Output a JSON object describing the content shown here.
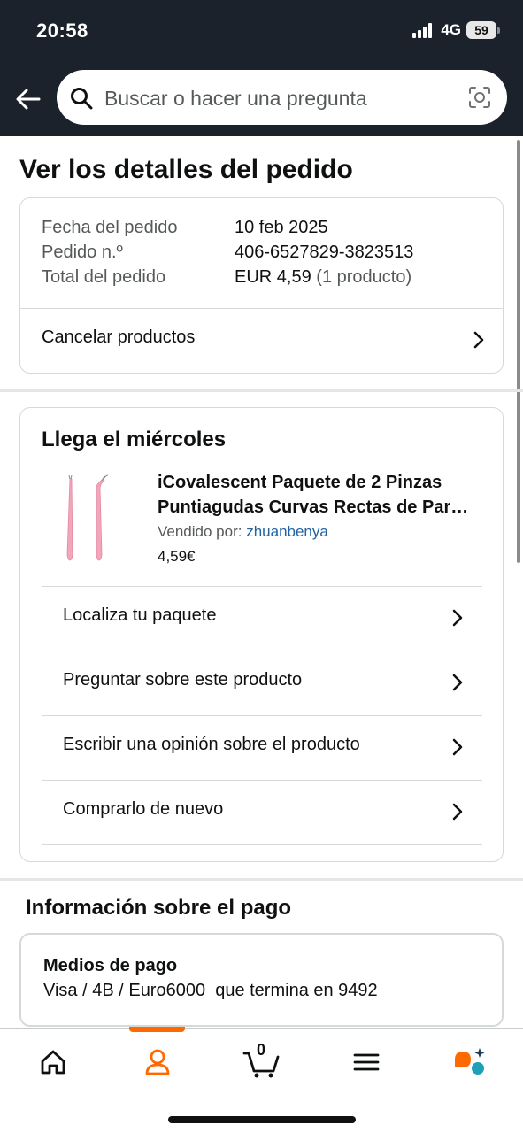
{
  "status_bar": {
    "time": "20:58",
    "network": "4G",
    "battery": "59"
  },
  "search": {
    "placeholder": "Buscar o hacer una pregunta"
  },
  "page": {
    "title": "Ver los detalles del pedido"
  },
  "order": {
    "date_label": "Fecha del pedido",
    "date_value": "10 feb 2025",
    "number_label": "Pedido n.º",
    "number_value": "406-6527829-3823513",
    "total_label": "Total del pedido",
    "total_value": "EUR 4,59",
    "total_count": "(1 producto)",
    "cancel_label": "Cancelar productos"
  },
  "delivery": {
    "title": "Llega el miércoles",
    "product_title": "iCovalescent Paquete de 2 Pinzas Puntiagudas Curvas Rectas de Par…",
    "sold_by_label": "Vendido por:",
    "seller": "zhuanbenya",
    "price": "4,59€",
    "actions": [
      {
        "label": "Localiza tu paquete"
      },
      {
        "label": "Preguntar sobre este producto"
      },
      {
        "label": "Escribir una opinión sobre el producto"
      },
      {
        "label": "Comprarlo de nuevo"
      }
    ]
  },
  "payment": {
    "section_title": "Información sobre el pago",
    "methods_label": "Medios de pago",
    "method_value": "Visa / 4B / Euro6000  que termina en 9492"
  },
  "bottom_nav": {
    "cart_count": "0",
    "items": [
      "home-icon",
      "account-icon",
      "cart-icon",
      "menu-icon",
      "rufus-icon"
    ],
    "accent_color": "#ff6a00"
  }
}
